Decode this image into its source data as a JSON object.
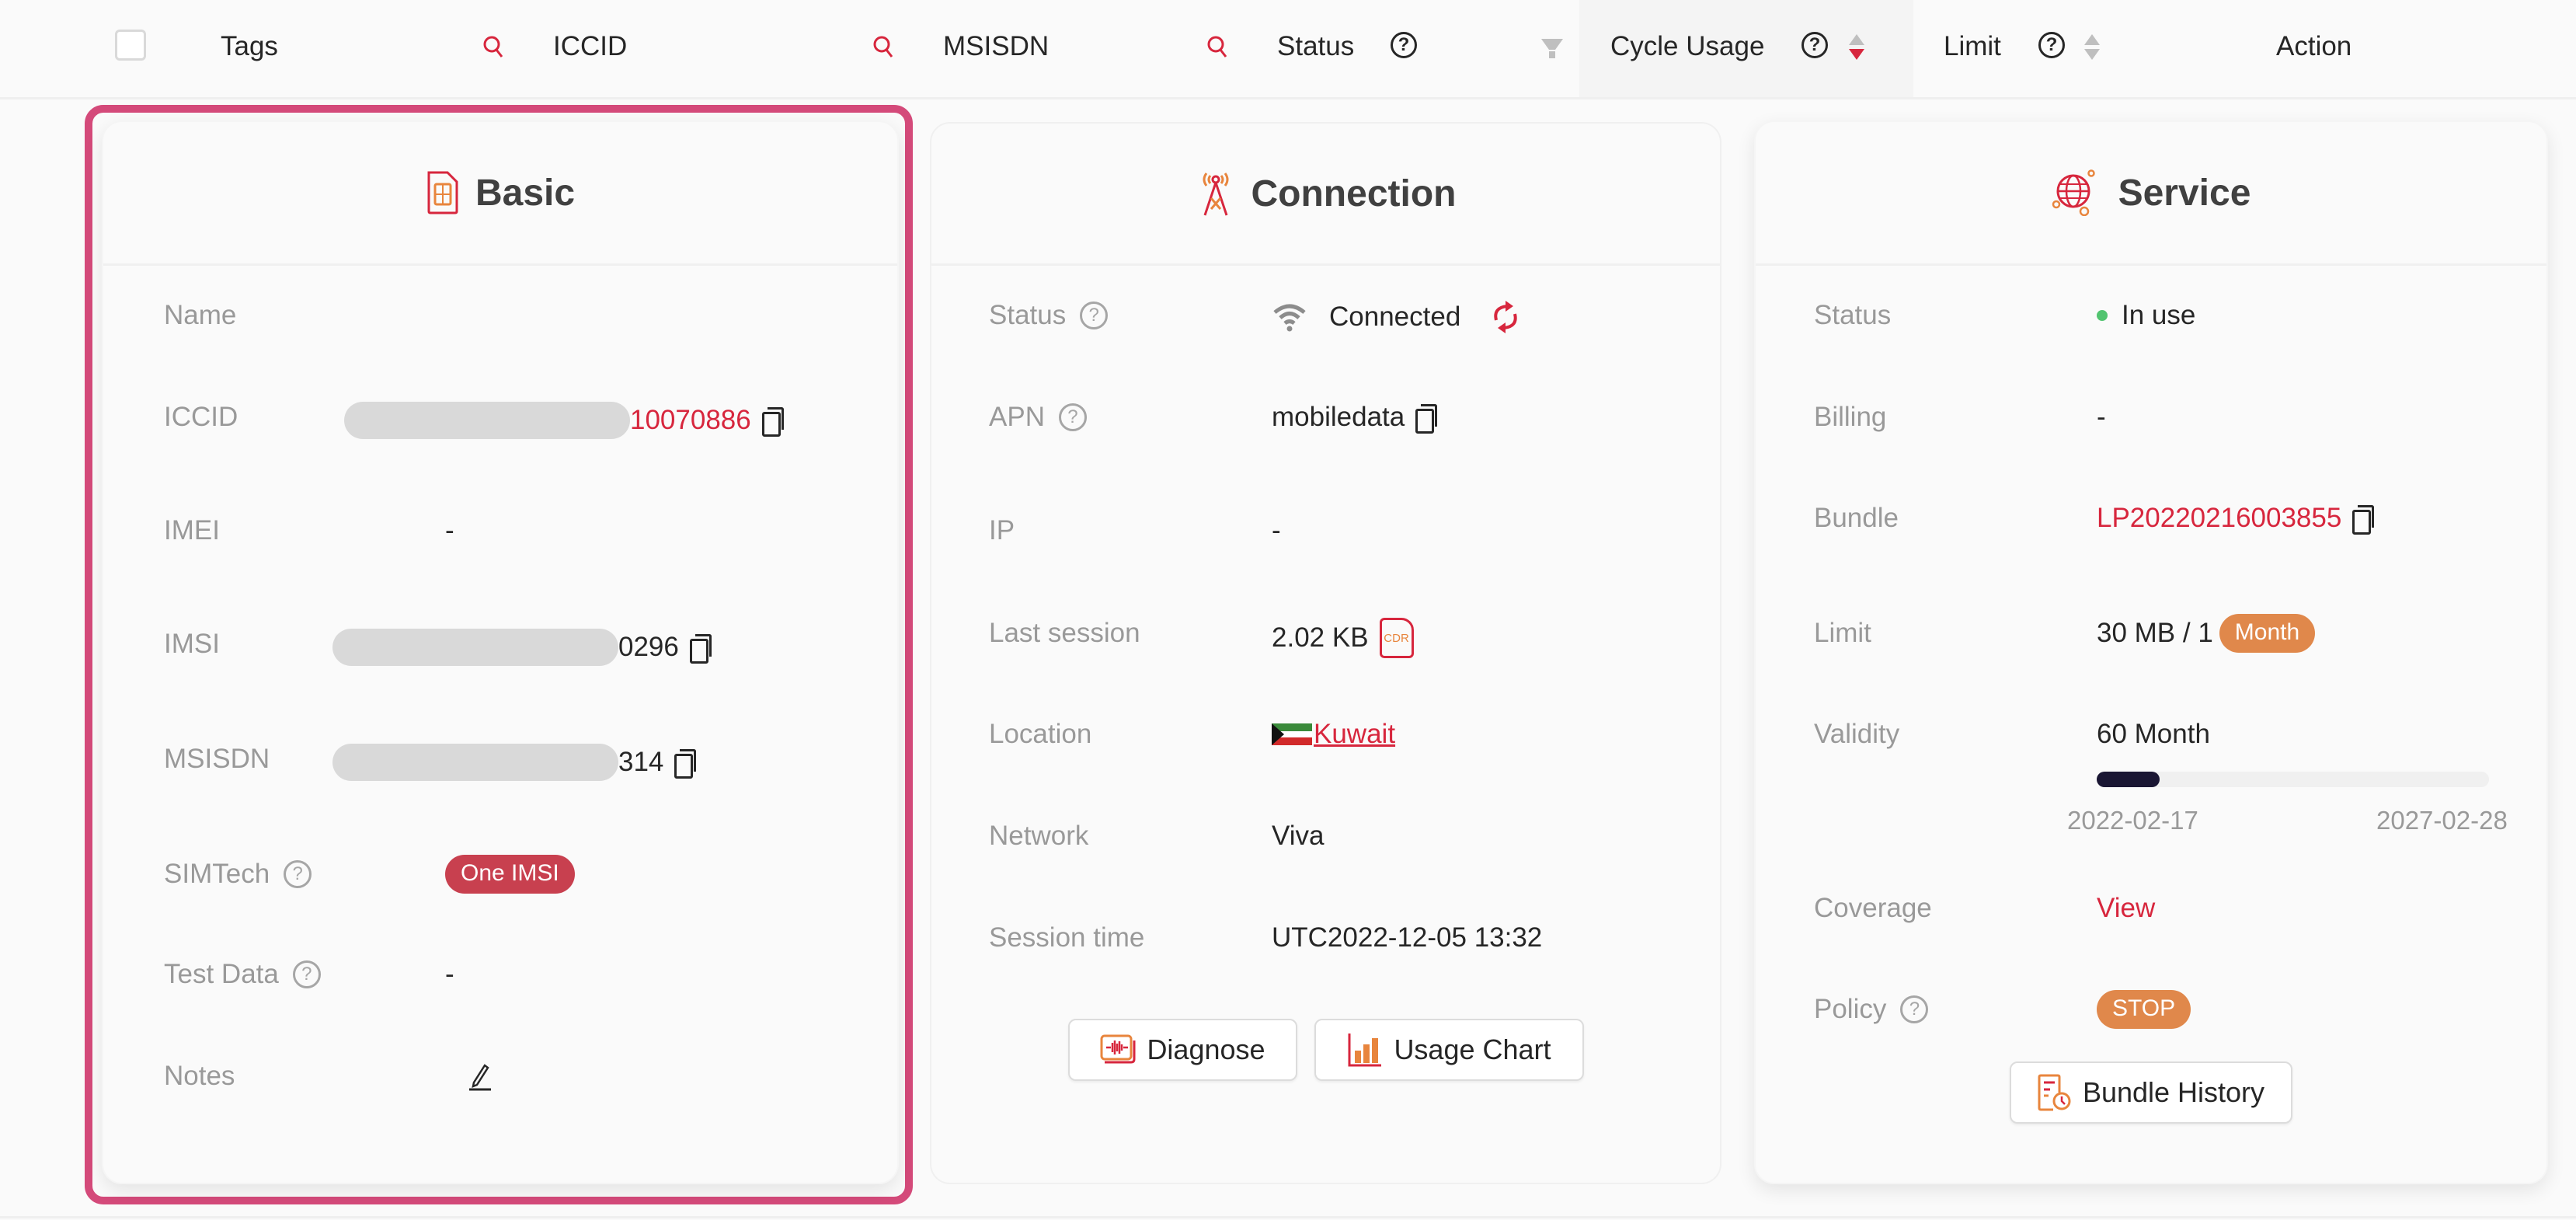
{
  "header": {
    "select_all": false,
    "columns": [
      {
        "label": "Tags",
        "icon": "search-icon"
      },
      {
        "label": "ICCID",
        "icon": "search-icon"
      },
      {
        "label": "MSISDN",
        "icon": "search-icon"
      },
      {
        "label": "Status",
        "help": "?",
        "icon": "filter-icon"
      },
      {
        "label": "Cycle Usage",
        "help": "?",
        "sort": "descending"
      },
      {
        "label": "Limit",
        "help": "?",
        "sort": "none"
      },
      {
        "label": "Action"
      }
    ]
  },
  "basic": {
    "title": "Basic",
    "icon": "sim-card-icon",
    "rows": {
      "name": {
        "label": "Name",
        "value": ""
      },
      "iccid": {
        "label": "ICCID",
        "value": "10070886",
        "masked": true
      },
      "imei": {
        "label": "IMEI",
        "value": "-"
      },
      "imsi": {
        "label": "IMSI",
        "value": "0296",
        "masked": true
      },
      "msisdn": {
        "label": "MSISDN",
        "value": "314",
        "masked": true
      },
      "simtech": {
        "label": "SIMTech",
        "help": "?",
        "value": "One IMSI"
      },
      "test_data": {
        "label": "Test Data",
        "help": "?",
        "value": "-"
      },
      "notes": {
        "label": "Notes",
        "value": ""
      }
    }
  },
  "connection": {
    "title": "Connection",
    "icon": "cell-tower-icon",
    "rows": {
      "status": {
        "label": "Status",
        "help": "?",
        "value": "Connected"
      },
      "apn": {
        "label": "APN",
        "help": "?",
        "value": "mobiledata"
      },
      "ip": {
        "label": "IP",
        "value": "-"
      },
      "last_session": {
        "label": "Last session",
        "value": "2.02 KB",
        "badge": "CDR"
      },
      "location": {
        "label": "Location",
        "value": "Kuwait"
      },
      "network": {
        "label": "Network",
        "value": "Viva"
      },
      "session_time": {
        "label": "Session time",
        "value": "UTC2022-12-05 13:32"
      }
    },
    "buttons": {
      "diagnose": "Diagnose",
      "usage_chart": "Usage Chart"
    }
  },
  "service": {
    "title": "Service",
    "icon": "globe-network-icon",
    "rows": {
      "status": {
        "label": "Status",
        "value": "In use",
        "color": "#52c470"
      },
      "billing": {
        "label": "Billing",
        "value": "-"
      },
      "bundle": {
        "label": "Bundle",
        "value": "LP20220216003855"
      },
      "limit": {
        "label": "Limit",
        "value": "30 MB / 1",
        "unit_badge": "Month"
      },
      "validity": {
        "label": "Validity",
        "value": "60 Month",
        "start": "2022-02-17",
        "end": "2027-02-28",
        "progress_percent": 16
      },
      "coverage": {
        "label": "Coverage",
        "value": "View"
      },
      "policy": {
        "label": "Policy",
        "help": "?",
        "value": "STOP"
      }
    },
    "buttons": {
      "bundle_history": "Bundle History"
    }
  },
  "colors": {
    "accent": "#d7263d",
    "highlight_border": "#d44a7a",
    "simtech_badge": "#c8404f",
    "orange_badge": "#e0884b",
    "progress_fill": "#1a1633"
  }
}
